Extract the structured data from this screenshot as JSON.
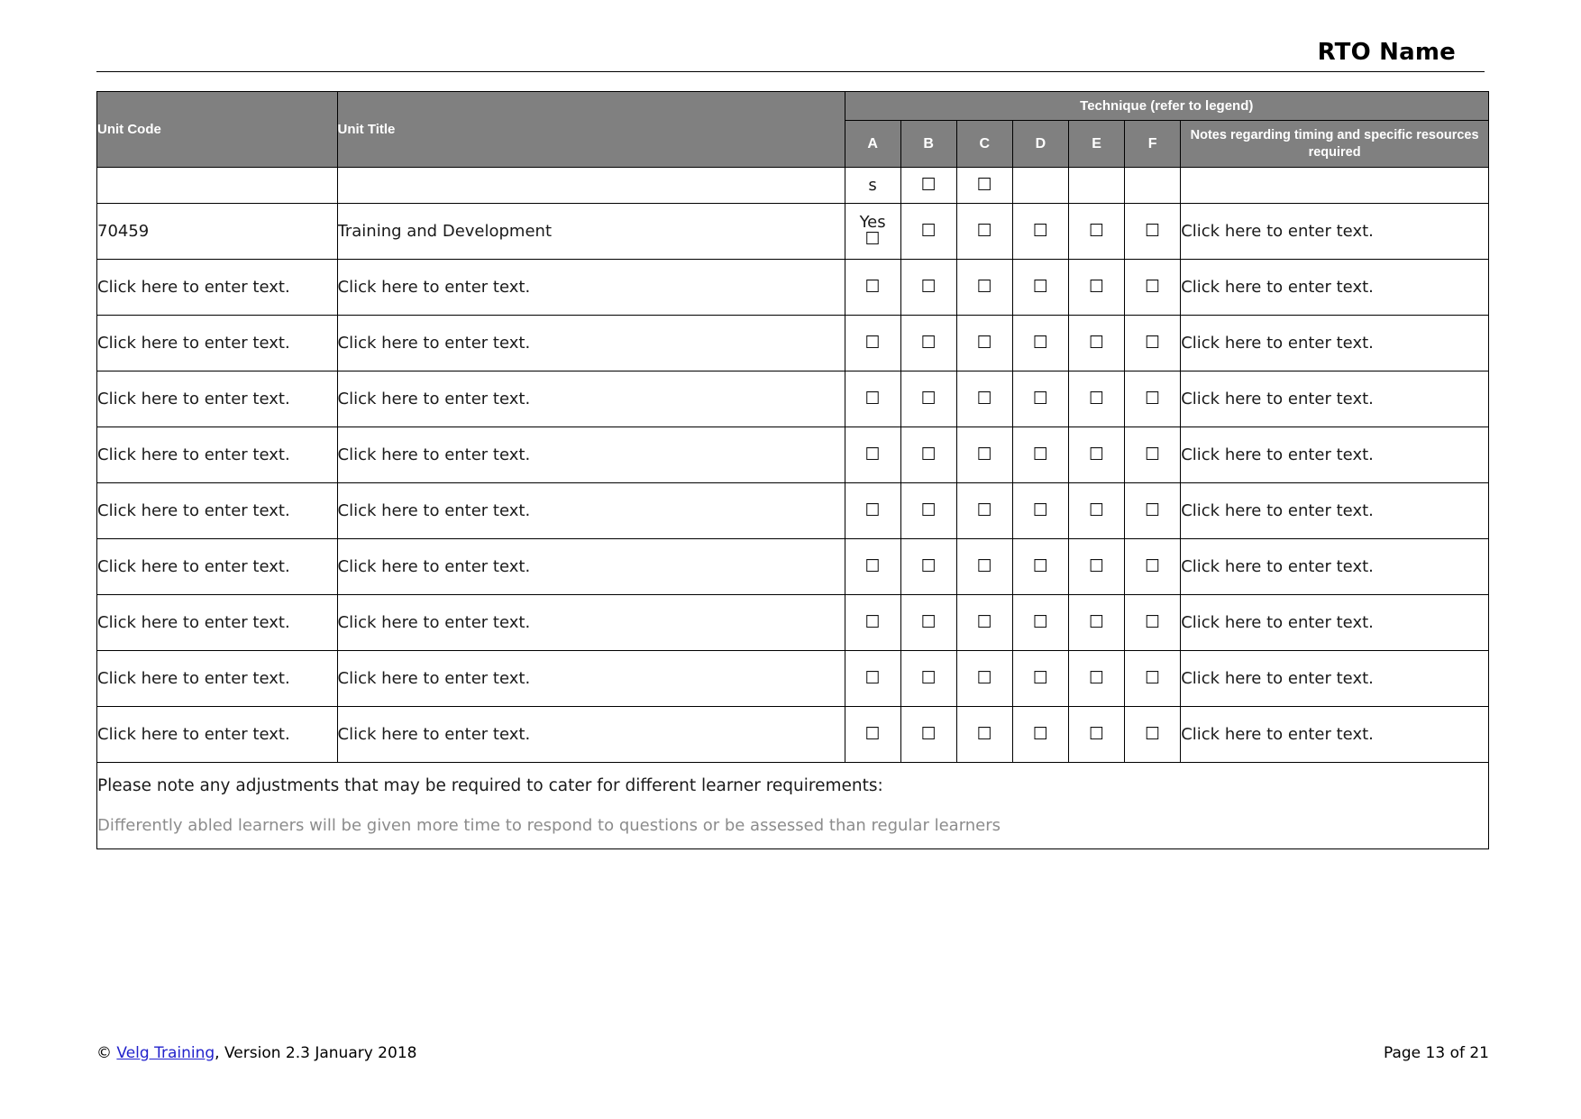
{
  "header": {
    "rto_name": "RTO Name"
  },
  "table": {
    "columns": {
      "unit_code": "Unit Code",
      "unit_title": "Unit Title",
      "technique_group": "Technique (refer to legend)",
      "letters": [
        "A",
        "B",
        "C",
        "D",
        "E",
        "F"
      ],
      "notes": "Notes regarding timing and specific resources required"
    },
    "checkbox_glyph": "☐",
    "rows": [
      {
        "unit_code": "",
        "unit_title": "",
        "a_text": "s",
        "a_kind": "text",
        "boxes": [
          false,
          true,
          true,
          false,
          false,
          false
        ],
        "notes": ""
      },
      {
        "unit_code": "70459",
        "unit_title": "Training and Development",
        "a_text": "Yes",
        "a_kind": "yes-box",
        "boxes": [
          true,
          true,
          true,
          true,
          true,
          true
        ],
        "notes": "Click here to enter text."
      },
      {
        "unit_code": "Click here to enter text.",
        "unit_title": "Click here to enter text.",
        "a_text": "",
        "a_kind": "box",
        "boxes": [
          true,
          true,
          true,
          true,
          true,
          true
        ],
        "notes": "Click here to enter text."
      },
      {
        "unit_code": "Click here to enter text.",
        "unit_title": "Click here to enter text.",
        "a_text": "",
        "a_kind": "box",
        "boxes": [
          true,
          true,
          true,
          true,
          true,
          true
        ],
        "notes": "Click here to enter text."
      },
      {
        "unit_code": "Click here to enter text.",
        "unit_title": "Click here to enter text.",
        "a_text": "",
        "a_kind": "box",
        "boxes": [
          true,
          true,
          true,
          true,
          true,
          true
        ],
        "notes": "Click here to enter text."
      },
      {
        "unit_code": "Click here to enter text.",
        "unit_title": "Click here to enter text.",
        "a_text": "",
        "a_kind": "box",
        "boxes": [
          true,
          true,
          true,
          true,
          true,
          true
        ],
        "notes": "Click here to enter text."
      },
      {
        "unit_code": "Click here to enter text.",
        "unit_title": "Click here to enter text.",
        "a_text": "",
        "a_kind": "box",
        "boxes": [
          true,
          true,
          true,
          true,
          true,
          true
        ],
        "notes": "Click here to enter text."
      },
      {
        "unit_code": "Click here to enter text.",
        "unit_title": "Click here to enter text.",
        "a_text": "",
        "a_kind": "box",
        "boxes": [
          true,
          true,
          true,
          true,
          true,
          true
        ],
        "notes": "Click here to enter text."
      },
      {
        "unit_code": "Click here to enter text.",
        "unit_title": "Click here to enter text.",
        "a_text": "",
        "a_kind": "box",
        "boxes": [
          true,
          true,
          true,
          true,
          true,
          true
        ],
        "notes": "Click here to enter text."
      },
      {
        "unit_code": "Click here to enter text.",
        "unit_title": "Click here to enter text.",
        "a_text": "",
        "a_kind": "box",
        "boxes": [
          true,
          true,
          true,
          true,
          true,
          true
        ],
        "notes": "Click here to enter text."
      },
      {
        "unit_code": "Click here to enter text.",
        "unit_title": "Click here to enter text.",
        "a_text": "",
        "a_kind": "box",
        "boxes": [
          true,
          true,
          true,
          true,
          true,
          true
        ],
        "notes": "Click here to enter text."
      }
    ],
    "adjustments": {
      "prompt": "Please note any adjustments that may be required to cater for different learner requirements:",
      "answer": "Differently abled learners will be given more time to respond to questions or be assessed than regular learners"
    }
  },
  "footer": {
    "copyright_symbol": "©",
    "link_text": "Velg Training",
    "version_text": ", Version 2.3 January 2018",
    "page_text": "Page 13 of 21"
  },
  "colors": {
    "header_gray": "#808080",
    "header_text": "#ffffff",
    "body_text": "#1a1a1a",
    "placeholder_gray": "#8c8c8c",
    "link_blue": "#2222cc"
  }
}
